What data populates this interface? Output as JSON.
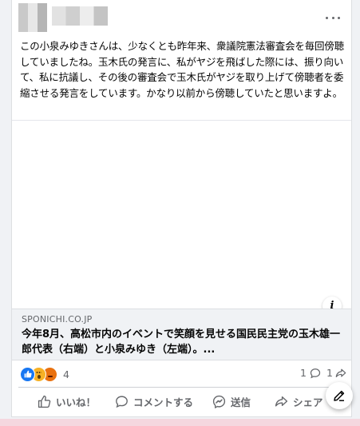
{
  "post": {
    "text": "この小泉みゆきさんは、少なくとも昨年来、衆議院憲法審査会を毎回傍聴していましたね。玉木氏の発言に、私がヤジを飛ばした際には、振り向いて、私に抗議し、その後の審査会で玉木氏がヤジを取り上げて傍聴者を委縮させる発言をしています。かなり以前から傍聴していたと思いますよ。"
  },
  "link_preview": {
    "domain": "SPONICHI.CO.JP",
    "title": "今年8月、高松市内のイベントで笑顔を見せる国民民主党の玉木雄一郎代表（右端）と小泉みゆき（左端）。..."
  },
  "stats": {
    "reaction_count": "4",
    "comment_count": "1",
    "share_count": "1"
  },
  "actions": {
    "like": "いいね！",
    "comment": "コメントする",
    "send": "送信",
    "share": "シェア"
  },
  "colors": {
    "accent": "#1877f2",
    "secondary_text": "#65676b"
  }
}
